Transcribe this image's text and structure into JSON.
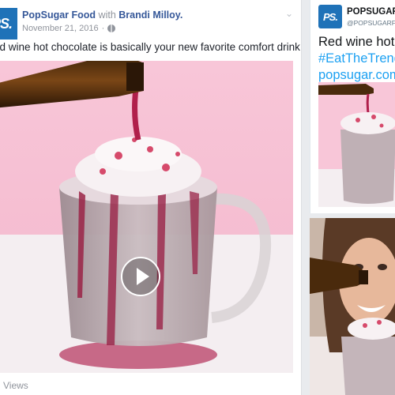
{
  "facebook_post": {
    "logo_text": "PS.",
    "page_name": "PopSugar Food",
    "with_text": "with",
    "tagged_person": "Brandi Milloy.",
    "date": "November 21, 2016",
    "date_separator": "·",
    "caption": "ed wine hot chocolate is basically your new favorite comfort drink.",
    "views_label": "d Views",
    "icons": [
      "globe-icon",
      "chevron-down-icon",
      "play-icon"
    ]
  },
  "tweet": {
    "logo_text": "PS.",
    "name": "POPSUGAR",
    "handle": "@POPSUGARFo",
    "text_line1": "Red wine hot c",
    "text_line2": "#EatTheTrend C",
    "text_line3": "popsugar.com"
  },
  "colors": {
    "brand_blue": "#1f72b8",
    "facebook_link": "#365899",
    "twitter_link": "#1da1f2",
    "video_background": "#f7c4d5"
  }
}
